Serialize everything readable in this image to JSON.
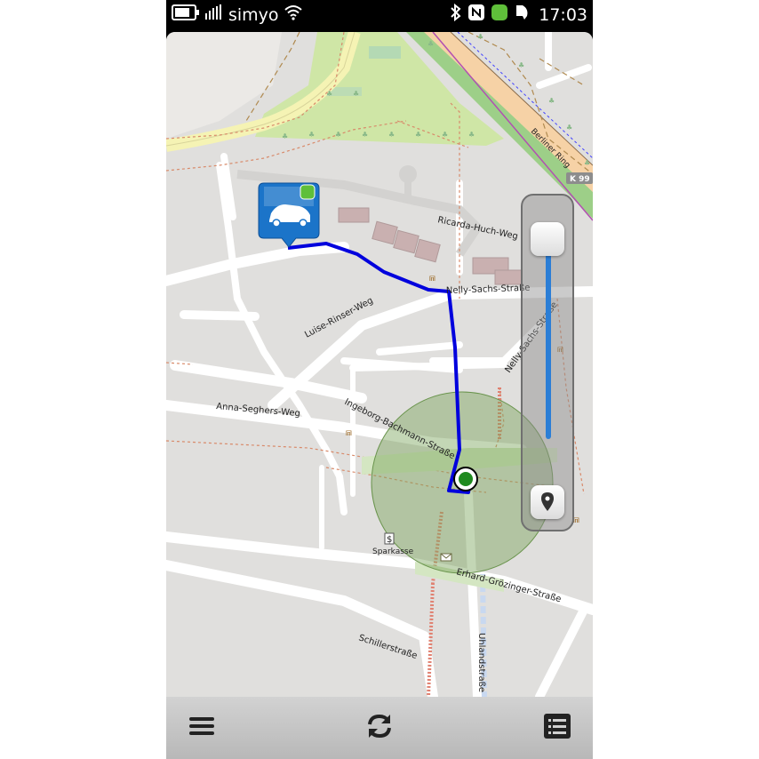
{
  "status_bar": {
    "carrier": "simyo",
    "time": "17:03",
    "icons": [
      "battery-icon",
      "signal-icon",
      "wifi-icon",
      "bluetooth-icon",
      "nfc-icon",
      "app-notification-icon",
      "notification-icon"
    ]
  },
  "map": {
    "streets": {
      "ricarda": "Ricarda-Huch-Weg",
      "nelly1": "Nelly-Sachs-Straße",
      "nelly2": "Nelly-Sachs-Straße",
      "luise": "Luise-Rinser-Weg",
      "anna": "Anna-Seghers-Weg",
      "ingeborg": "Ingeborg-Bachmann-Straße",
      "erhard": "Erhard-Grözinger-Straße",
      "schiller": "Schillerstraße",
      "uhland": "Uhlandstraße",
      "berliner": "Berliner Ring",
      "k99": "K 99"
    },
    "poi": {
      "bank": "Sparkasse"
    },
    "colors": {
      "route": "#0000dd",
      "accuracy_circle": "#7aa35c",
      "zoom_track": "#2b7ed6",
      "car_marker": "#1b74c9"
    }
  },
  "toolbar": {
    "menu": "menu-icon",
    "refresh": "refresh-icon",
    "list": "list-icon"
  }
}
